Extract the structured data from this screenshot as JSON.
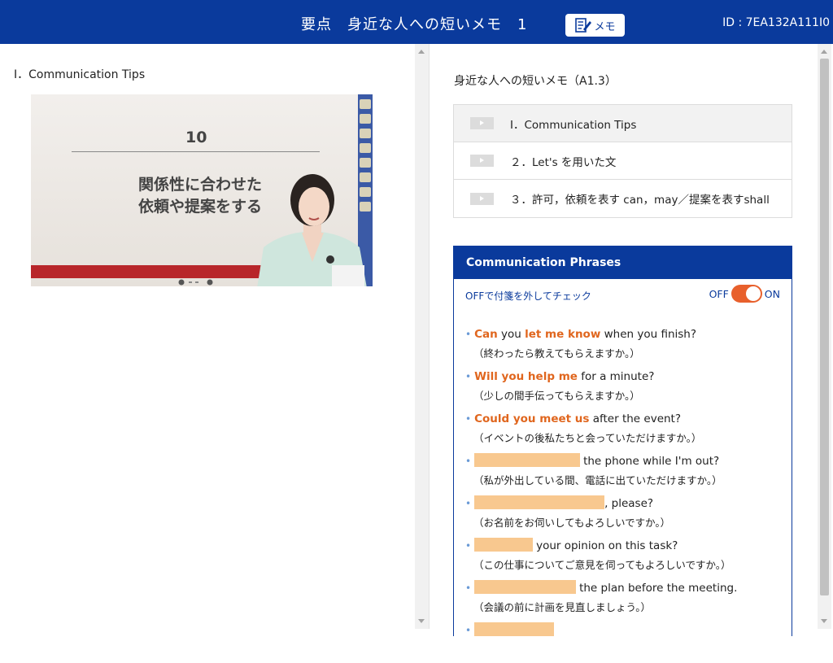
{
  "header": {
    "title": "要点　身近な人への短いメモ　1",
    "memo_label": "メモ",
    "id_text": "ID : 7EA132A111I0",
    "bg_color": "#0a3a9c"
  },
  "left": {
    "section_title": "Ⅰ．Communication Tips",
    "video": {
      "slide_number": "10",
      "slide_text_line1": "関係性に合わせた",
      "slide_text_line2": "依頼や提案をする"
    }
  },
  "right": {
    "unit_title": "身近な人への短いメモ（A1.3）",
    "lessons": [
      {
        "label": "Ⅰ．Communication Tips",
        "active": true
      },
      {
        "label": "２．Let's を用いた文",
        "active": false
      },
      {
        "label": "３．許可，依頼を表す can，may／提案を表すshall",
        "active": false
      }
    ],
    "phrases": {
      "heading": "Communication Phrases",
      "subtitle": "OFFで付箋を外してチェック",
      "toggle_off": "OFF",
      "toggle_on": "ON",
      "accent_color": "#e0661e",
      "items": [
        {
          "hl1": "Can",
          "t1": " you ",
          "hl2": "let me know",
          "t2": " when you finish?",
          "ja": "（終わったら教えてもらえますか。）"
        },
        {
          "hl1": "Will you help me",
          "t1": " for a minute?",
          "ja": "（少しの間手伝ってもらえますか。）"
        },
        {
          "hl1": "Could you meet us",
          "t1": " after the event?",
          "ja": "（イベントの後私たちと会っていただけますか。）"
        },
        {
          "rest": "the phone while I'm out?",
          "ja": "（私が外出している間、電話に出ていただけますか。）"
        },
        {
          "rest": ", please?",
          "ja": "（お名前をお伺いしてもよろしいですか。）"
        },
        {
          "rest": "your opinion on this task?",
          "ja": "（この仕事についてご意見を伺ってもよろしいですか。）"
        },
        {
          "rest": "the plan before the meeting.",
          "ja": "（会議の前に計画を見直しましょう。）"
        }
      ]
    }
  }
}
